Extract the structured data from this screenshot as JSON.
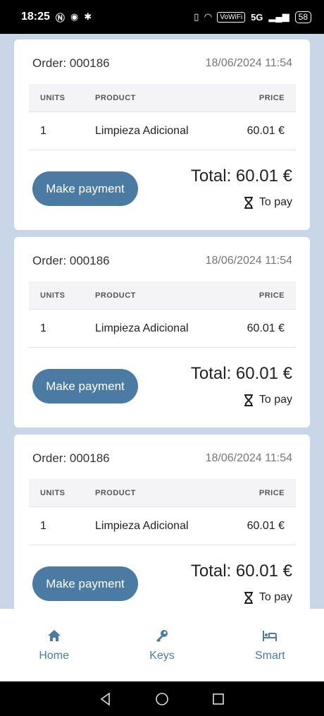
{
  "status_bar": {
    "time": "18:25",
    "icons_left": [
      "nfc-icon",
      "notification-icon",
      "bluetooth-icon"
    ],
    "vowifi": "VoWiFi",
    "network": "5G",
    "battery": "58"
  },
  "orders": [
    {
      "order_label": "Order: 000186",
      "date": "18/06/2024 11:54",
      "table": {
        "headers": {
          "units": "UNITS",
          "product": "PRODUCT",
          "price": "PRICE"
        },
        "rows": [
          {
            "units": "1",
            "product": "Limpieza Adicional",
            "price": "60.01 €"
          }
        ]
      },
      "pay_button": "Make payment",
      "total": "Total: 60.01 €",
      "status": "To pay"
    },
    {
      "order_label": "Order: 000186",
      "date": "18/06/2024 11:54",
      "table": {
        "headers": {
          "units": "UNITS",
          "product": "PRODUCT",
          "price": "PRICE"
        },
        "rows": [
          {
            "units": "1",
            "product": "Limpieza Adicional",
            "price": "60.01 €"
          }
        ]
      },
      "pay_button": "Make payment",
      "total": "Total: 60.01 €",
      "status": "To pay"
    },
    {
      "order_label": "Order: 000186",
      "date": "18/06/2024 11:54",
      "table": {
        "headers": {
          "units": "UNITS",
          "product": "PRODUCT",
          "price": "PRICE"
        },
        "rows": [
          {
            "units": "1",
            "product": "Limpieza Adicional",
            "price": "60.01 €"
          }
        ]
      },
      "pay_button": "Make payment",
      "total": "Total: 60.01 €",
      "status": "To pay"
    }
  ],
  "bottom_nav": [
    {
      "label": "Home",
      "icon": "home-icon"
    },
    {
      "label": "Keys",
      "icon": "key-icon"
    },
    {
      "label": "Smart",
      "icon": "bed-icon"
    }
  ],
  "colors": {
    "accent": "#4b7ba2",
    "background": "#c8d6e8",
    "card": "#ffffff"
  }
}
